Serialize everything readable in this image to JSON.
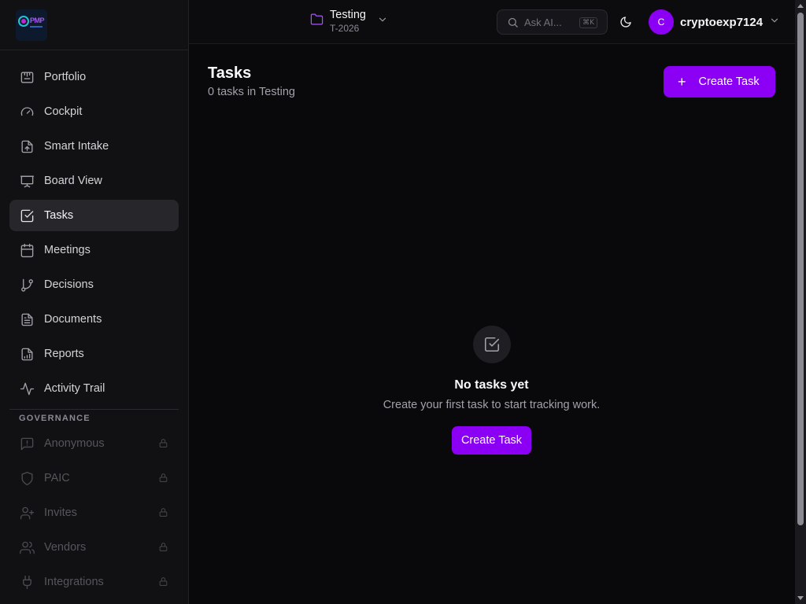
{
  "sidebar": {
    "nav": [
      {
        "label": "Portfolio",
        "icon": "portfolio-icon"
      },
      {
        "label": "Cockpit",
        "icon": "gauge-icon"
      },
      {
        "label": "Smart Intake",
        "icon": "file-upload-icon"
      },
      {
        "label": "Board View",
        "icon": "presentation-icon"
      },
      {
        "label": "Tasks",
        "icon": "checkbox-icon",
        "active": true
      },
      {
        "label": "Meetings",
        "icon": "calendar-icon"
      },
      {
        "label": "Decisions",
        "icon": "git-branch-icon"
      },
      {
        "label": "Documents",
        "icon": "document-icon"
      },
      {
        "label": "Reports",
        "icon": "report-icon"
      },
      {
        "label": "Activity Trail",
        "icon": "activity-icon"
      }
    ],
    "governance_title": "GOVERNANCE",
    "governance": [
      {
        "label": "Anonymous",
        "icon": "message-alert-icon"
      },
      {
        "label": "PAIC",
        "icon": "shield-icon"
      },
      {
        "label": "Invites",
        "icon": "user-plus-icon"
      },
      {
        "label": "Vendors",
        "icon": "users-icon"
      },
      {
        "label": "Integrations",
        "icon": "plug-icon"
      }
    ]
  },
  "header": {
    "project_name": "Testing",
    "project_code": "T-2026",
    "search_placeholder": "Ask AI...",
    "search_shortcut": "⌘K",
    "username": "cryptoexp7124",
    "avatar_initial": "C"
  },
  "main": {
    "title": "Tasks",
    "subtitle": "0 tasks in Testing",
    "create_button": "Create Task",
    "empty_title": "No tasks yet",
    "empty_subtitle": "Create your first task to start tracking work.",
    "empty_button": "Create Task"
  },
  "colors": {
    "accent": "#8b00f5",
    "background": "#09090b",
    "sidebar": "#111114"
  }
}
